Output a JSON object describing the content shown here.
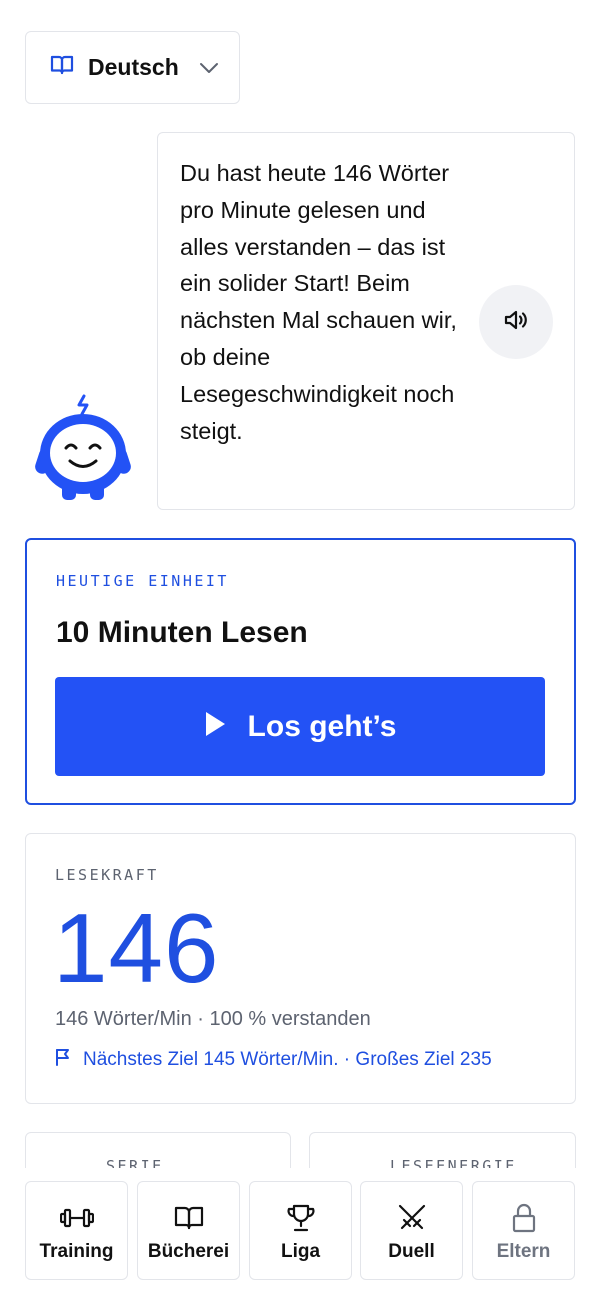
{
  "language_selector": {
    "label": "Deutsch"
  },
  "coach": {
    "message": "Du hast heute 146 Wörter pro Minute gelesen und alles verstanden – das ist ein solider Start! Beim nächsten Mal schauen wir, ob deine Lesegeschwindigkeit noch steigt."
  },
  "today": {
    "kicker": "HEUTIGE EINHEIT",
    "title": "10 Minuten Lesen",
    "cta_label": "Los geht’s"
  },
  "reading_power": {
    "kicker": "LESEKRAFT",
    "value": "146",
    "summary": "146 Wörter/Min · 100 % verstanden",
    "goal": "Nächstes Ziel 145 Wörter/Min. · Großes Ziel 235"
  },
  "mini_cards": {
    "streak_kicker": "SERIE",
    "energy_kicker": "LESEENERGIE"
  },
  "nav": {
    "items": [
      {
        "label": "Training",
        "icon": "dumbbell-icon"
      },
      {
        "label": "Bücherei",
        "icon": "book-icon"
      },
      {
        "label": "Liga",
        "icon": "trophy-icon"
      },
      {
        "label": "Duell",
        "icon": "crossed-swords-icon"
      },
      {
        "label": "Eltern",
        "icon": "lock-icon",
        "locked": true
      }
    ]
  },
  "colors": {
    "accent": "#2352f5",
    "accent_text": "#1f4fe0",
    "muted": "#5d6370",
    "border": "#e3e5ea"
  }
}
